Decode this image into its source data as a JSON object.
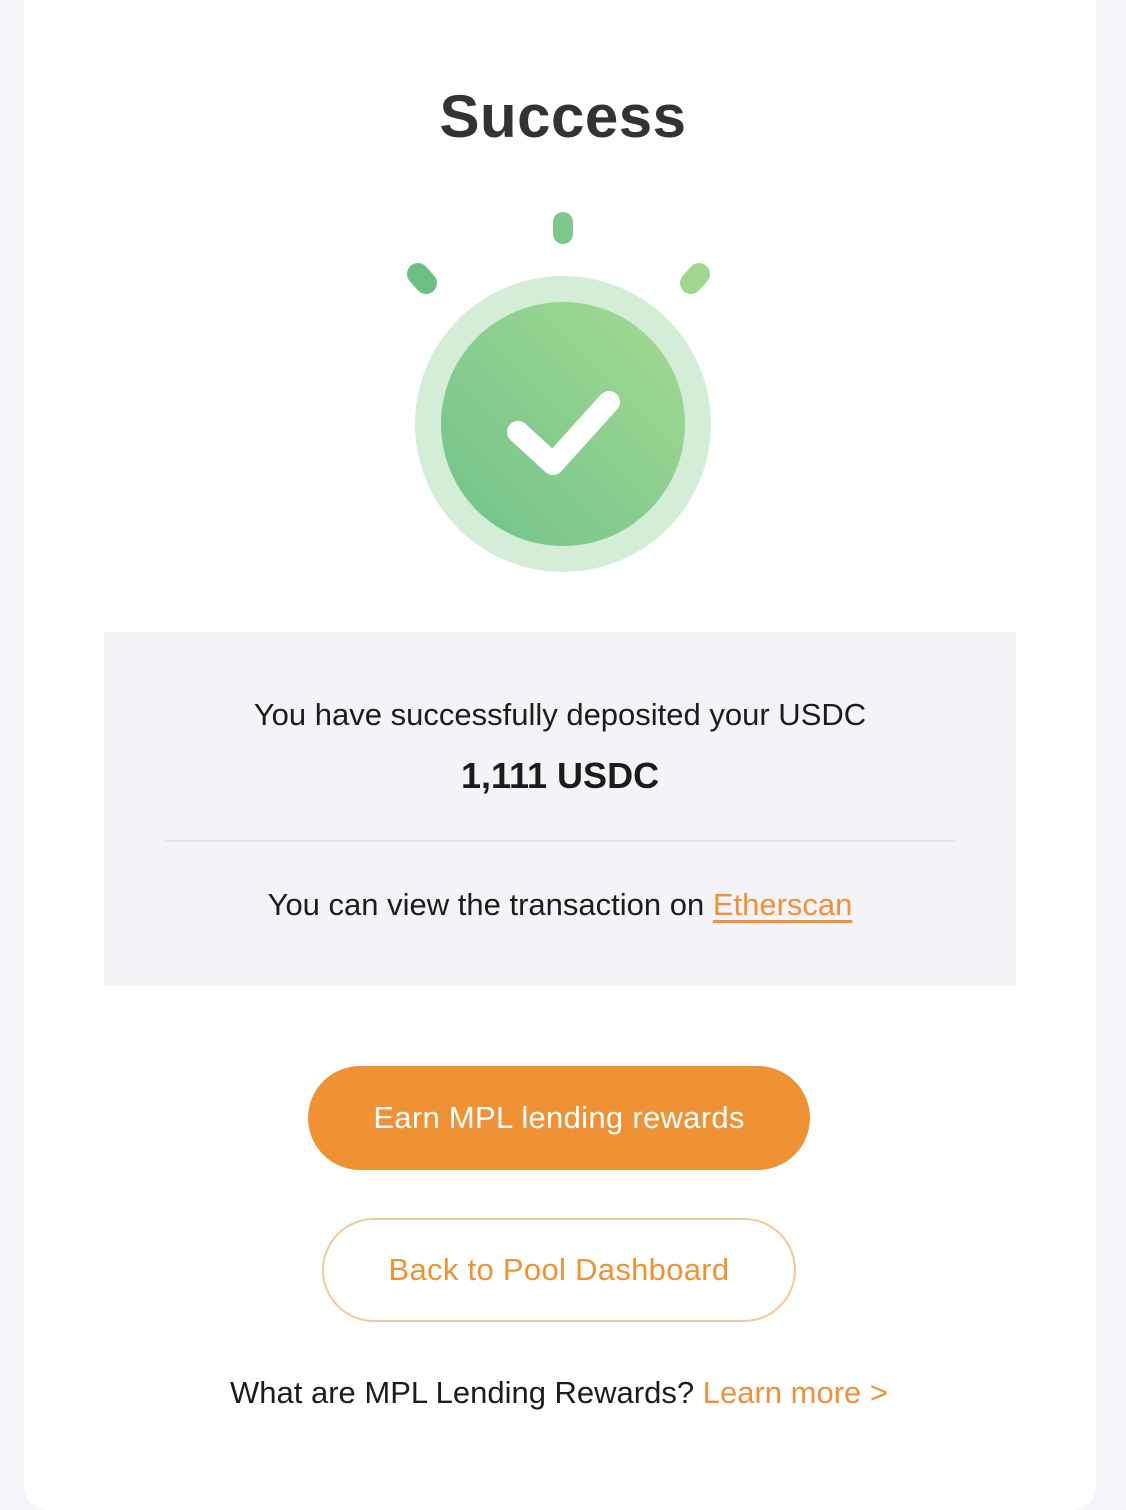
{
  "header": {
    "title": "Success"
  },
  "icons": {
    "status": "check-circle-icon"
  },
  "colors": {
    "accent": "#EF9236",
    "accent_border": "#F3C89A",
    "success_light": "#D4EDD6",
    "success_start": "#70C28A",
    "success_end": "#A0D890",
    "panel_bg": "#F4F4F8",
    "page_bg": "#F5F5F9"
  },
  "summary": {
    "message": "You have successfully deposited your USDC",
    "amount": "1,111 USDC",
    "tx_prefix": "You can view the transaction on ",
    "tx_link": "Etherscan"
  },
  "actions": {
    "primary_label": "Earn MPL lending rewards",
    "secondary_label": "Back to Pool Dashboard"
  },
  "footer": {
    "question": "What are MPL Lending Rewards? ",
    "link": "Learn more >"
  }
}
